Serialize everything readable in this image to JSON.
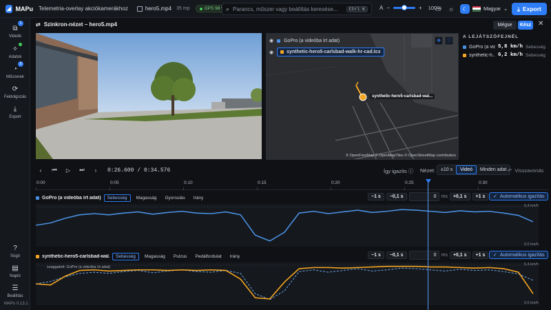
{
  "app": {
    "name": "MAPu",
    "tagline": "Telemetria-overlay akciókamerákhoz",
    "version": "MAPu 0.13.1"
  },
  "file": {
    "name": "hero5.mp4",
    "size": "35 mp",
    "gps": "GPS 98 %"
  },
  "search": {
    "placeholder": "Parancs, műszer vagy beállítás keresése...",
    "shortcut": "Ctrl K"
  },
  "zoom": {
    "value": "100%",
    "level": 0.4
  },
  "language": "Magyar",
  "export_label": "Export",
  "sidebar": [
    {
      "label": "Videók",
      "icon": "film-icon",
      "badge": "1"
    },
    {
      "label": "Adatok",
      "icon": "data-icon",
      "dot": true
    },
    {
      "label": "Műszerek",
      "icon": "gauge-icon",
      "badge": "8"
    },
    {
      "label": "Feldolgozás",
      "icon": "process-icon"
    },
    {
      "label": "Export",
      "icon": "download-icon"
    }
  ],
  "sidebar_bottom": [
    {
      "label": "Súgó",
      "icon": "help-icon"
    },
    {
      "label": "Napló",
      "icon": "log-icon"
    },
    {
      "label": "Beállítás",
      "icon": "settings-icon"
    }
  ],
  "sync": {
    "title": "Szinkron-nézet – hero5.mp4",
    "cancel": "Mégse",
    "done": "Kész"
  },
  "map": {
    "layers": [
      {
        "label": "GoPro (a videóba írt adat)",
        "color": "#4a90e2"
      },
      {
        "label": "synthetic-hero5-carlsbad-walk-hr-cad.tcx",
        "color": "#f5a623"
      }
    ],
    "marker_label": "synthetic-hero5-carlsbad-wal...",
    "attribution": "© OpenFreeMap © OpenMapTiles © OpenStreetMap contributors"
  },
  "playhead": {
    "title": "A LEJÁTSZÓFEJNÉL",
    "rows": [
      {
        "name": "GoPro (a vid...",
        "value": "5,8 km/h",
        "unit": "Sebesség",
        "color": "#4a90e2"
      },
      {
        "name": "synthetic-h...",
        "value": "6,2 km/h",
        "unit": "Sebesség",
        "color": "#f5a623"
      }
    ]
  },
  "transport": {
    "current": "0:26.600",
    "total": "0:34.576",
    "separator": "/",
    "align_label": "Így igazíts",
    "view_label": "Nézet:",
    "view_options": [
      "±10 s",
      "Videó",
      "Minden adat"
    ],
    "view_selected": 1,
    "reset": "Visszavonás"
  },
  "timeline": {
    "ticks": [
      "0:00",
      "0:05",
      "0:10",
      "0:15",
      "0:20",
      "0:25",
      "0:30"
    ],
    "duration_s": 34.576,
    "current_s": 26.6
  },
  "tracks": [
    {
      "name": "GoPro (a videóba írt adat)",
      "color": "#4a90e2",
      "tabs": [
        "Sebesség",
        "Magasság",
        "Gyorsulás",
        "Irány"
      ],
      "active_tab": 0,
      "offset": "0",
      "unit": "ms",
      "auto_label": "Automatikus igazítás",
      "ymax": "6,4 km/h",
      "ymin": "0,0 km/h"
    },
    {
      "name": "synthetic-hero5-carlsbad-wal...",
      "color": "#f5a623",
      "tabs": [
        "Sebesség",
        "Magasság",
        "Pulzus",
        "Pedálfordulat",
        "Irány"
      ],
      "active_tab": 0,
      "offset": "0",
      "unit": "ms",
      "auto_label": "Automatikus igazítás",
      "ymax": "6,4 km/h",
      "ymin": "0,0 km/h",
      "overlay_note": "szaggatott: GoPro (a videóba írt adat)"
    }
  ],
  "nudge": [
    "−1 s",
    "−0,1 s",
    "+0,1 s",
    "+1 s"
  ],
  "chart_data": [
    {
      "type": "line",
      "title": "GoPro (a videóba írt adat) – Sebesség",
      "ylabel": "km/h",
      "ylim": [
        0,
        6.4
      ],
      "x": [
        0,
        1,
        2,
        3,
        4,
        5,
        6,
        7,
        8,
        9,
        10,
        11,
        12,
        13,
        14,
        15,
        16,
        17,
        18,
        19,
        20,
        21,
        22,
        23,
        24,
        25,
        26,
        27,
        28,
        29,
        30,
        31,
        32,
        33,
        34
      ],
      "series": [
        {
          "name": "GoPro (a videóba írt adat)",
          "values": [
            3.2,
            3.6,
            4.4,
            5.0,
            5.2,
            5.0,
            5.3,
            5.5,
            5.1,
            5.4,
            5.6,
            5.3,
            5.2,
            5.5,
            5.0,
            1.5,
            0.5,
            2.0,
            5.3,
            5.6,
            5.2,
            5.5,
            5.8,
            5.4,
            5.6,
            5.9,
            5.8,
            5.6,
            5.4,
            5.7,
            5.5,
            5.6,
            5.3,
            4.9,
            3.8
          ]
        }
      ]
    },
    {
      "type": "line",
      "title": "synthetic-hero5-carlsbad-walk – Sebesség",
      "ylabel": "km/h",
      "ylim": [
        0,
        6.4
      ],
      "x": [
        0,
        1,
        2,
        3,
        4,
        5,
        6,
        7,
        8,
        9,
        10,
        11,
        12,
        13,
        14,
        15,
        16,
        17,
        18,
        19,
        20,
        21,
        22,
        23,
        24,
        25,
        26,
        27,
        28,
        29,
        30,
        31,
        32,
        33,
        34
      ],
      "series": [
        {
          "name": "synthetic-hero5-carlsbad-walk-hr-cad.tcx",
          "values": [
            3.2,
            3.0,
            4.5,
            5.5,
            5.6,
            5.4,
            5.5,
            5.6,
            5.6,
            5.5,
            5.6,
            5.5,
            5.6,
            5.5,
            4.0,
            0.8,
            0.6,
            3.5,
            5.8,
            6.0,
            6.0,
            5.9,
            6.0,
            6.1,
            6.2,
            6.2,
            6.2,
            6.1,
            6.1,
            6.0,
            5.9,
            6.0,
            5.8,
            5.2,
            1.5
          ]
        },
        {
          "name": "GoPro (a videóba írt adat)",
          "values": [
            3.2,
            3.6,
            4.4,
            5.0,
            5.2,
            5.0,
            5.3,
            5.5,
            5.1,
            5.4,
            5.6,
            5.3,
            5.2,
            5.5,
            5.0,
            1.5,
            0.5,
            2.0,
            5.3,
            5.6,
            5.2,
            5.5,
            5.8,
            5.4,
            5.6,
            5.9,
            5.8,
            5.6,
            5.4,
            5.7,
            5.5,
            5.6,
            5.3,
            4.9,
            3.8
          ]
        }
      ]
    }
  ]
}
